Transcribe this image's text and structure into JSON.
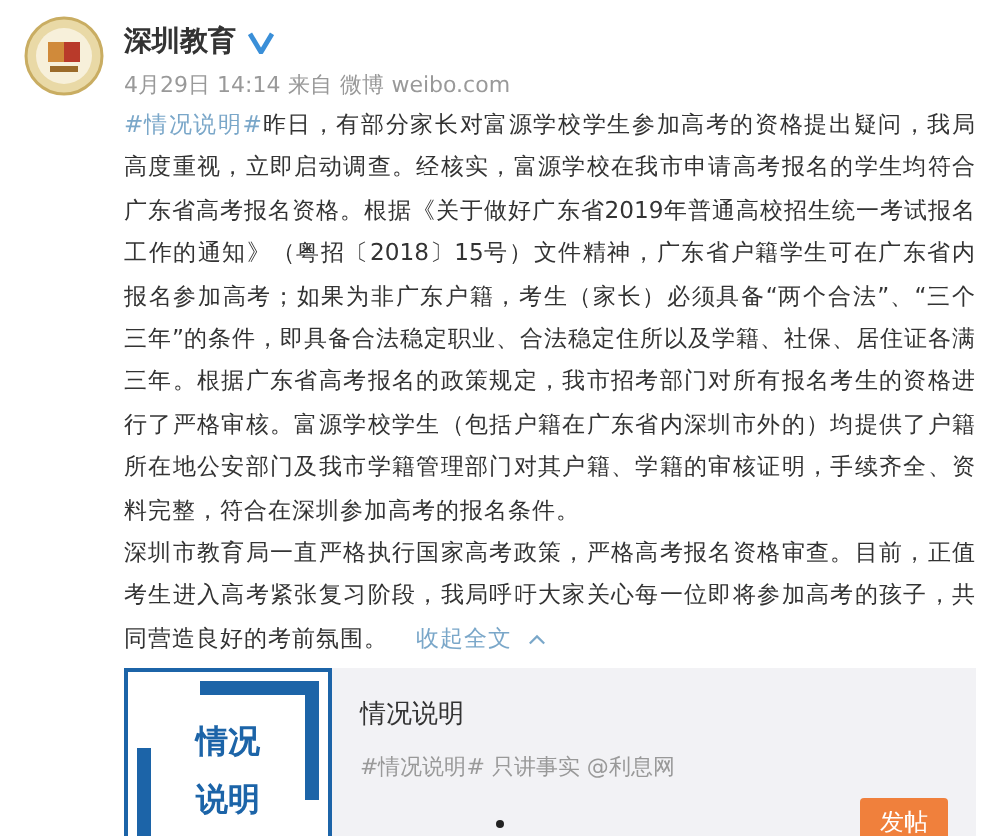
{
  "author": {
    "name": "深圳教育",
    "verified": true
  },
  "meta": {
    "time": "4月29日 14:14",
    "source_prefix": "来自",
    "source": "微博 weibo.com"
  },
  "post": {
    "hashtag": "#情况说明#",
    "paragraphs": [
      "昨日，有部分家长对富源学校学生参加高考的资格提出疑问，我局高度重视，立即启动调查。经核实，富源学校在我市申请高考报名的学生均符合广东省高考报名资格。根据《关于做好广东省2019年普通高校招生统一考试报名工作的通知》（粤招〔2018〕15号）文件精神，广东省户籍学生可在广东省内报名参加高考；如果为非广东户籍，考生（家长）必须具备“两个合法”、“三个三年”的条件，即具备合法稳定职业、合法稳定住所以及学籍、社保、居住证各满三年。根据广东省高考报名的政策规定，我市招考部门对所有报名考生的资格进行了严格审核。富源学校学生（包括户籍在广东省内深圳市外的）均提供了户籍所在地公安部门及我市学籍管理部门对其户籍、学籍的审核证明，手续齐全、资料完整，符合在深圳参加高考的报名条件。",
      "深圳市教育局一直严格执行国家高考政策，严格高考报名资格审查。目前，正值考生进入高考紧张复习阶段，我局呼吁大家关心每一位即将参加高考的孩子，共同营造良好的考前氛围。"
    ],
    "collapse_link": "收起全文"
  },
  "card": {
    "thumbnail_text": [
      "情况",
      "说明"
    ],
    "title": "情况说明",
    "description": "#情况说明# 只讲事实 @利息网",
    "button": "发帖"
  }
}
